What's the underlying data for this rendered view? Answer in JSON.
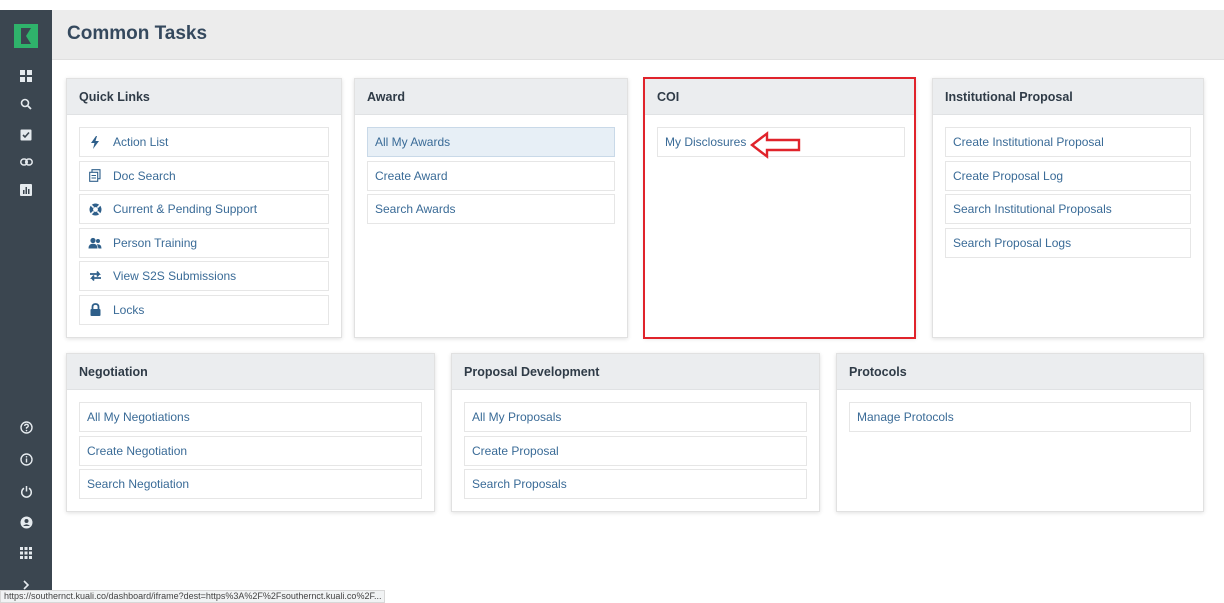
{
  "header": {
    "title": "Common Tasks"
  },
  "rail": {
    "icons": [
      "dashboard-icon",
      "search-icon",
      "clipboard-check-icon",
      "link-icon",
      "bar-chart-icon",
      "help-icon",
      "info-icon",
      "power-icon",
      "user-icon",
      "grid-icon",
      "chevron-right-icon"
    ]
  },
  "cards": {
    "quick_links": {
      "title": "Quick Links",
      "items": [
        "Action List",
        "Doc Search",
        "Current & Pending Support",
        "Person Training",
        "View S2S Submissions",
        "Locks"
      ],
      "icons": [
        "bolt-icon",
        "document-icon",
        "lifebuoy-icon",
        "users-icon",
        "swap-icon",
        "lock-icon"
      ]
    },
    "award": {
      "title": "Award",
      "items": [
        "All My Awards",
        "Create Award",
        "Search Awards"
      ],
      "active_item": "All My Awards"
    },
    "coi": {
      "title": "COI",
      "items": [
        "My Disclosures"
      ]
    },
    "institutional_proposal": {
      "title": "Institutional Proposal",
      "items": [
        "Create Institutional Proposal",
        "Create Proposal Log",
        "Search Institutional Proposals",
        "Search Proposal Logs"
      ]
    },
    "negotiation": {
      "title": "Negotiation",
      "items": [
        "All My Negotiations",
        "Create Negotiation",
        "Search Negotiation"
      ]
    },
    "proposal_development": {
      "title": "Proposal Development",
      "items": [
        "All My Proposals",
        "Create Proposal",
        "Search Proposals"
      ]
    },
    "protocols": {
      "title": "Protocols",
      "items": [
        "Manage Protocols"
      ]
    }
  },
  "annotation": {
    "color": "#e0232b"
  },
  "status_url": "https://southernct.kuali.co/dashboard/iframe?dest=https%3A%2F%2Fsouthernct.kuali.co%2F...",
  "colors": {
    "rail": "#3b4650",
    "logo": "#2fb36b",
    "link": "#3a6b97",
    "accent": "#e0232b"
  }
}
